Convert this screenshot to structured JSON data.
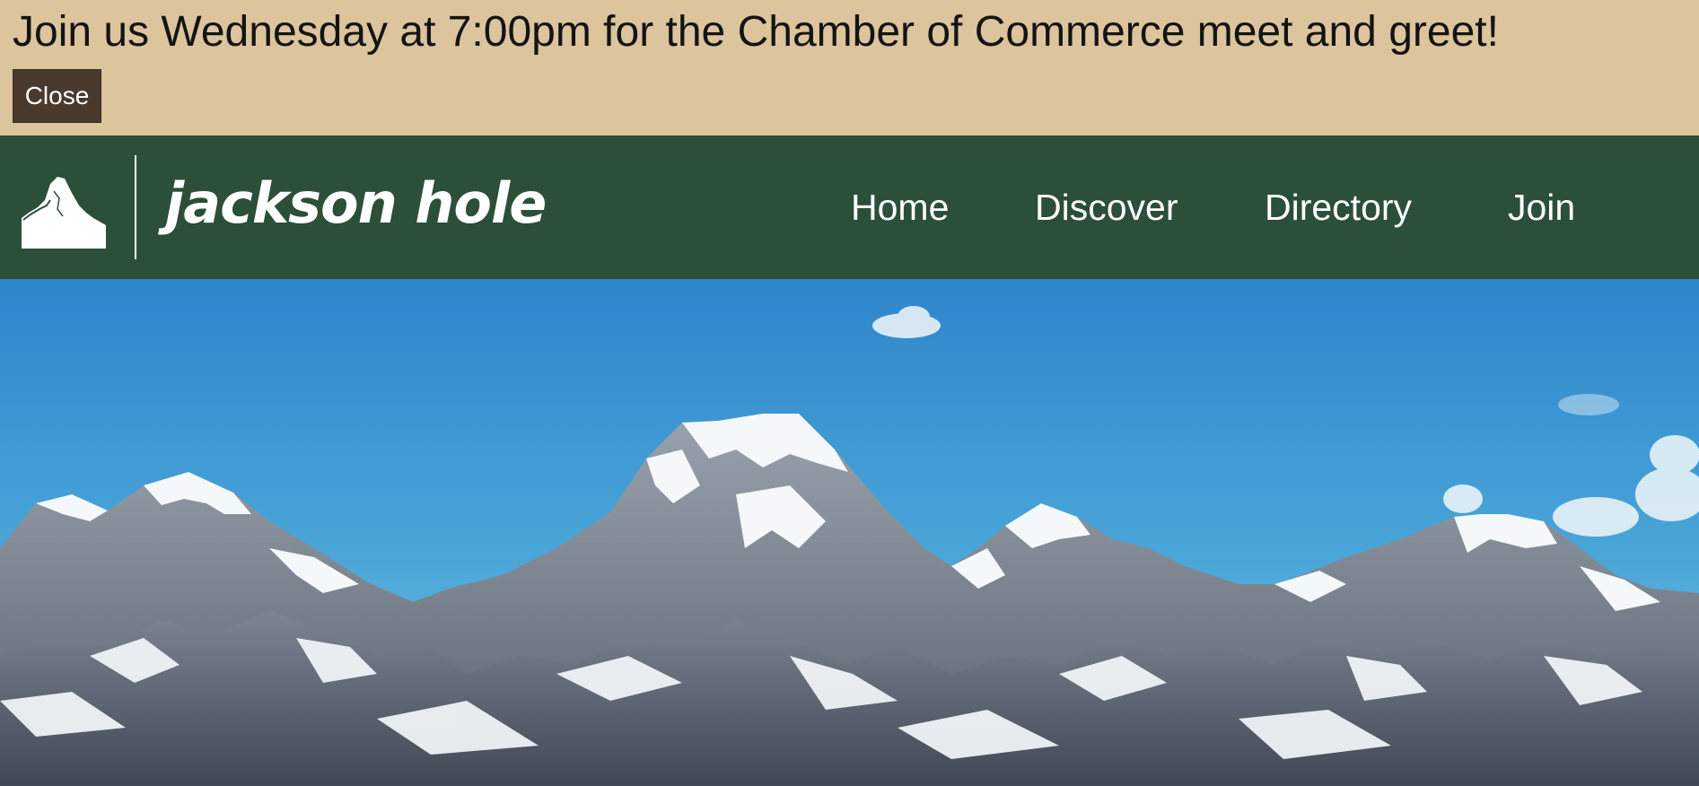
{
  "announcement": {
    "message": "Join us Wednesday at 7:00pm for the Chamber of Commerce meet and greet!",
    "close_label": "Close"
  },
  "header": {
    "logo_icon": "mountain-logo-icon",
    "site_name": "jackson hole",
    "nav": [
      {
        "label": "Home"
      },
      {
        "label": "Discover"
      },
      {
        "label": "Directory"
      },
      {
        "label": "Join"
      }
    ]
  },
  "hero": {
    "image": "snow-capped mountain range under blue sky"
  },
  "colors": {
    "banner_bg": "#dcc49d",
    "close_button_bg": "#4a3a2e",
    "header_bg": "#2b4f38",
    "text_light": "#ffffff",
    "sky_top": "#2f86cc",
    "sky_bottom": "#6fc0e2"
  }
}
